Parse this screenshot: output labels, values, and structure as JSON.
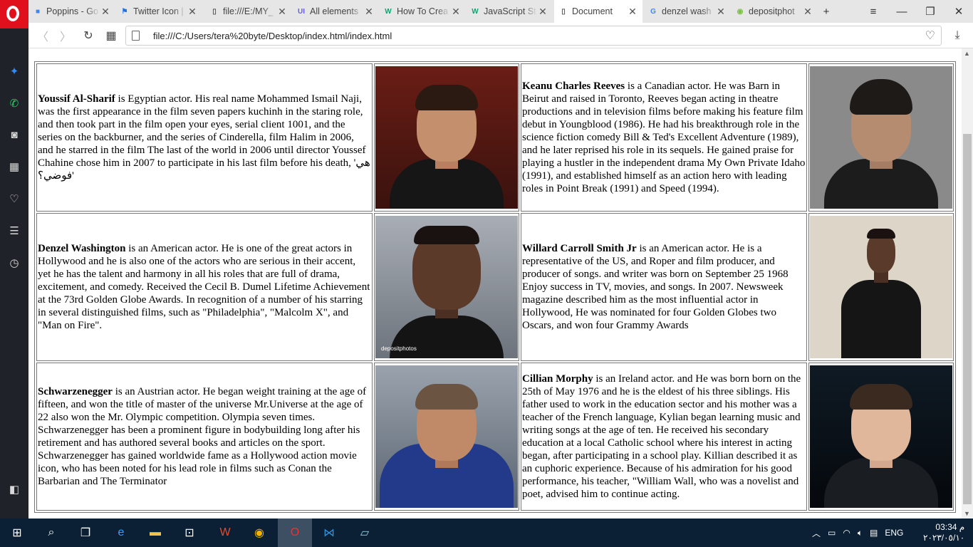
{
  "browser": {
    "tabs": [
      {
        "label": "Poppins - Go",
        "icon": "google-fonts-icon",
        "color": "#4285f4"
      },
      {
        "label": "Twitter Icon |",
        "icon": "flag-icon",
        "color": "#1a73e8"
      },
      {
        "label": "file:///E:/MY_",
        "icon": "file-icon",
        "color": "#555555"
      },
      {
        "label": "All elements",
        "icon": "ui-icon",
        "color": "#6b5ce7"
      },
      {
        "label": "How To Crea",
        "icon": "w3schools-icon",
        "color": "#04aa6d"
      },
      {
        "label": "JavaScript St",
        "icon": "w3schools-icon",
        "color": "#04aa6d"
      },
      {
        "label": "Document",
        "icon": "file-icon",
        "color": "#555555"
      },
      {
        "label": "denzel wash",
        "icon": "google-icon",
        "color": "#4285f4"
      },
      {
        "label": "depositphot",
        "icon": "depositphotos-icon",
        "color": "#7ac143"
      }
    ],
    "active_tab": 6,
    "url": "file:///C:/Users/tera%20byte/Desktop/index.html/index.html"
  },
  "actors": [
    {
      "left": {
        "name": "Youssif Al-Sharif",
        "bio": " is Egyptian actor. His real name Mohammed Ismail Naji, was the first appearance in the film seven papers kuchinh in the staring role, and then took part in the film open your eyes, serial client 1001, and the series on the backburner, and the series of Cinderella, film Halim in 2006, and he starred in the film The last of the world in 2006 until director Youssef Chahine chose him in 2007 to participate in his last film before his death, 'هي فوضي؟'",
        "photo": "youssif-al-sharif-photo"
      },
      "right": {
        "name": "Keanu Charles Reeves",
        "bio": " is a Canadian actor. He was Barn in Beirut and raised in Toronto, Reeves began acting in theatre productions and in television films before making his feature film debut in Youngblood (1986). He had his breakthrough role in the science fiction comedy Bill & Ted's Excellent Adventure (1989), and he later reprised his role in its sequels. He gained praise for playing a hustler in the independent drama My Own Private Idaho (1991), and established himself as an action hero with leading roles in Point Break (1991) and Speed (1994).",
        "photo": "keanu-reeves-photo"
      }
    },
    {
      "left": {
        "name": "Denzel Washington",
        "bio": " is an American actor. He is one of the great actors in Hollywood and he is also one of the actors who are serious in their accent, yet he has the talent and harmony in all his roles that are full of drama, excitement, and comedy. Received the Cecil B. Dumel Lifetime Achievement at the 73rd Golden Globe Awards. In recognition of a number of his starring in several distinguished films, such as \"Philadelphia\", \"Malcolm X\", and \"Man on Fire\".",
        "photo": "denzel-washington-photo",
        "watermark": "depositphotos"
      },
      "right": {
        "name": "Willard Carroll Smith Jr",
        "bio": " is an American actor. He is a representative of the US, and Roper and film producer, and producer of songs. and writer was born on September 25 1968 Enjoy success in TV, movies, and songs. In 2007. Newsweek magazine described him as the most influential actor in Hollywood, He was nominated for four Golden Globes two Oscars, and won four Grammy Awards",
        "photo": "will-smith-photo"
      }
    },
    {
      "left": {
        "name": "Schwarzenegger",
        "bio": " is an Austrian actor. He began weight training at the age of fifteen, and won the title of master of the universe Mr.Universe at the age of 22 also won the Mr. Olympic competition. Olympia seven times. Schwarzenegger has been a prominent figure in bodybuilding long after his retirement and has authored several books and articles on the sport. Schwarzenegger has gained worldwide fame as a Hollywood action movie icon, who has been noted for his lead role in films such as Conan the Barbarian and The Terminator",
        "photo": "schwarzenegger-photo"
      },
      "right": {
        "name": "Cillian Morphy",
        "bio": " is an Ireland actor. and He was born born on the 25th of May 1976 and he is the eldest of his three siblings. His father used to work in the education sector and his mother was a teacher of the French language, Kylian began learning music and writing songs at the age of ten. He received his secondary education at a local Catholic school where his interest in acting began, after participating in a school play. Killian described it as an cuphoric experience. Because of his admiration for his good performance, his teacher, \"William Wall, who was a novelist and poet, advised him to continue acting.",
        "photo": "cillian-murphy-photo"
      }
    }
  ],
  "taskbar": {
    "apps": [
      "windows-start-icon",
      "search-icon",
      "task-view-icon",
      "edge-icon",
      "file-explorer-icon",
      "store-icon",
      "wps-office-icon",
      "chrome-icon",
      "opera-icon",
      "vscode-icon",
      "notepad-icon"
    ],
    "language": "ENG",
    "time": "03:34 م",
    "date": "٢٠٢٣/٠٥/١٠"
  },
  "colors": {
    "opera_red": "#e0111c",
    "sidebar_bg": "#1f2228",
    "taskbar_bg": "#0b2035"
  }
}
